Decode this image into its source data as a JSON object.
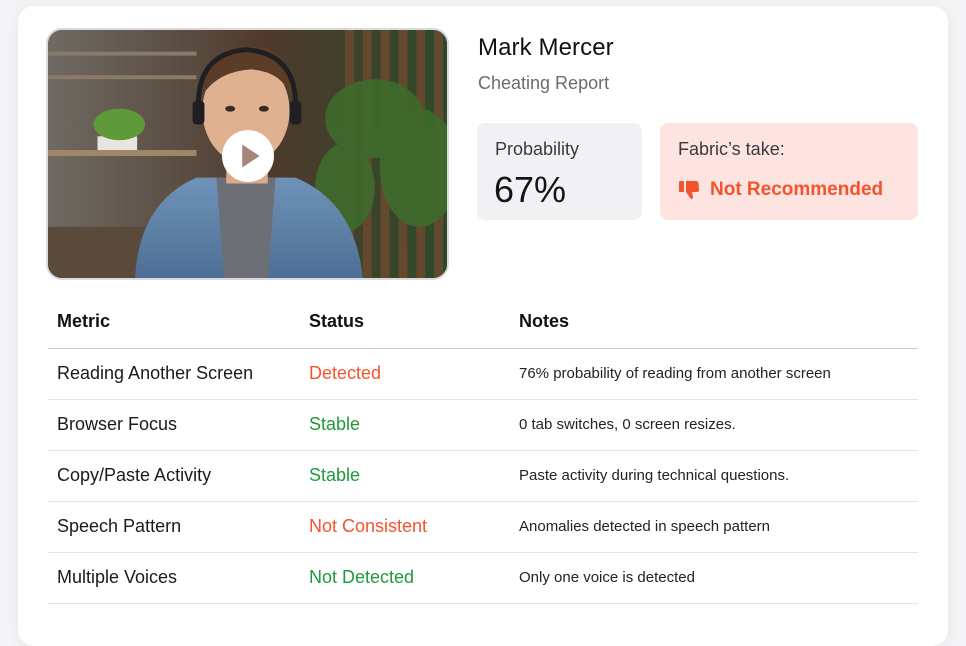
{
  "candidate": {
    "name": "Mark Mercer",
    "report_title": "Cheating Report"
  },
  "video": {
    "play_icon": "play-icon"
  },
  "probability": {
    "label": "Probability",
    "value": "67%"
  },
  "take": {
    "label": "Fabric’s take:",
    "value": "Not Recommended",
    "icon": "thumbs-down-icon",
    "color": "#f2542d"
  },
  "table": {
    "headers": [
      "Metric",
      "Status",
      "Notes"
    ],
    "rows": [
      {
        "metric": "Reading Another Screen",
        "status": "Detected",
        "tone": "bad",
        "note": "76% probability of reading from another screen"
      },
      {
        "metric": "Browser Focus",
        "status": "Stable",
        "tone": "good",
        "note": "0 tab switches, 0 screen resizes."
      },
      {
        "metric": "Copy/Paste Activity",
        "status": "Stable",
        "tone": "good",
        "note": "Paste activity during technical questions."
      },
      {
        "metric": "Speech Pattern",
        "status": "Not Consistent",
        "tone": "bad",
        "note": "Anomalies detected in speech pattern"
      },
      {
        "metric": "Multiple Voices",
        "status": "Not Detected",
        "tone": "good",
        "note": "Only one voice is detected"
      }
    ]
  },
  "colors": {
    "bad": "#f2542d",
    "good": "#1f9a3a"
  }
}
